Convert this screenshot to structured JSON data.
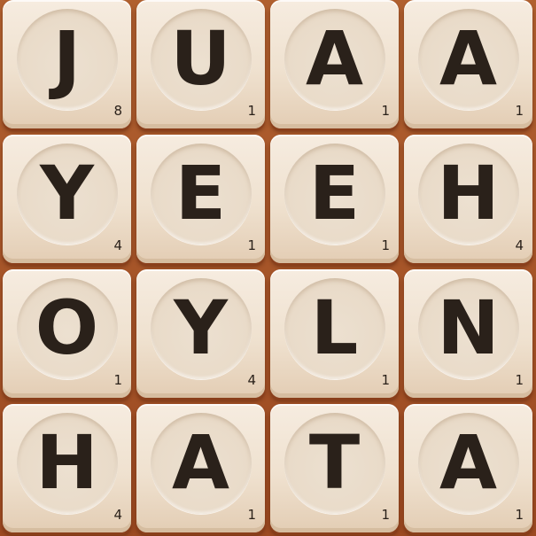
{
  "board": {
    "tiles": [
      {
        "letter": "J",
        "points": "8"
      },
      {
        "letter": "U",
        "points": "1"
      },
      {
        "letter": "A",
        "points": "1"
      },
      {
        "letter": "A",
        "points": "1"
      },
      {
        "letter": "Y",
        "points": "4"
      },
      {
        "letter": "E",
        "points": "1"
      },
      {
        "letter": "E",
        "points": "1"
      },
      {
        "letter": "H",
        "points": "4"
      },
      {
        "letter": "O",
        "points": "1"
      },
      {
        "letter": "Y",
        "points": "4"
      },
      {
        "letter": "L",
        "points": "1"
      },
      {
        "letter": "N",
        "points": "1"
      },
      {
        "letter": "H",
        "points": "4"
      },
      {
        "letter": "A",
        "points": "1"
      },
      {
        "letter": "T",
        "points": "1"
      },
      {
        "letter": "A",
        "points": "1"
      }
    ]
  },
  "colors": {
    "board_background": "#a8552a",
    "tile_face": "#f6ece0",
    "letter_ink": "#2a211a"
  }
}
